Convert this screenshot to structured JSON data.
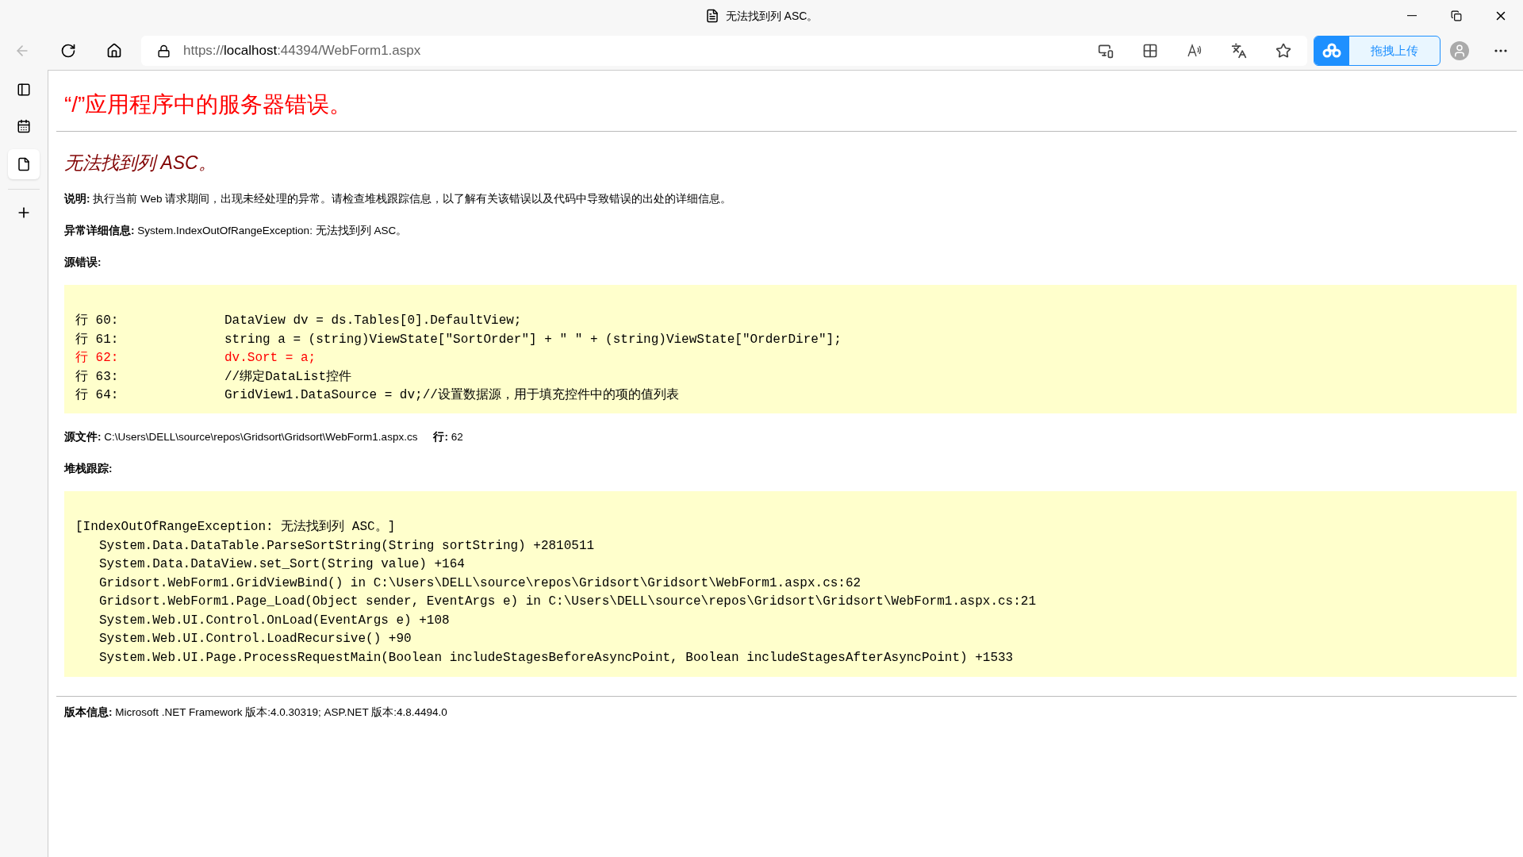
{
  "window": {
    "title": "无法找到列 ASC。"
  },
  "address_bar": {
    "scheme": "https://",
    "host": "localhost",
    "path": ":44394/WebForm1.aspx"
  },
  "upload_button": {
    "label": "拖拽上传"
  },
  "sidebar": {
    "items": [
      {
        "kind": "tabs",
        "selected": false
      },
      {
        "kind": "calendar",
        "selected": false
      },
      {
        "kind": "page",
        "selected": true
      }
    ]
  },
  "page": {
    "heading": "“/”应用程序中的服务器错误。",
    "subheading": "无法找到列 ASC。",
    "description": {
      "label": "说明:",
      "text": "执行当前 Web 请求期间，出现未经处理的异常。请检查堆栈跟踪信息，以了解有关该错误以及代码中导致错误的出处的详细信息。"
    },
    "exception_details": {
      "label": "异常详细信息:",
      "text": "System.IndexOutOfRangeException: 无法找到列 ASC。"
    },
    "source_error": {
      "label": "源错误:",
      "lines": [
        {
          "prefix": "行 60:",
          "code": "DataView dv = ds.Tables[0].DefaultView;",
          "error": false
        },
        {
          "prefix": "行 61:",
          "code": "string a = (string)ViewState[\"SortOrder\"] + \" \" + (string)ViewState[\"OrderDire\"];",
          "error": false
        },
        {
          "prefix": "行 62:",
          "code": "dv.Sort = a;",
          "error": true
        },
        {
          "prefix": "行 63:",
          "code": "//绑定DataList控件",
          "error": false
        },
        {
          "prefix": "行 64:",
          "code": "GridView1.DataSource = dv;//设置数据源，用于填充控件中的项的值列表",
          "error": false
        }
      ]
    },
    "source_file": {
      "label": "源文件:",
      "path": "C:\\Users\\DELL\\source\\repos\\Gridsort\\Gridsort\\WebForm1.aspx.cs",
      "line_label": "行:",
      "line": "62"
    },
    "stack_trace": {
      "label": "堆栈跟踪:",
      "exception": "[IndexOutOfRangeException: 无法找到列 ASC。]",
      "frames": [
        "System.Data.DataTable.ParseSortString(String sortString) +2810511",
        "System.Data.DataView.set_Sort(String value) +164",
        "Gridsort.WebForm1.GridViewBind() in C:\\Users\\DELL\\source\\repos\\Gridsort\\Gridsort\\WebForm1.aspx.cs:62",
        "Gridsort.WebForm1.Page_Load(Object sender, EventArgs e) in C:\\Users\\DELL\\source\\repos\\Gridsort\\Gridsort\\WebForm1.aspx.cs:21",
        "System.Web.UI.Control.OnLoad(EventArgs e) +108",
        "System.Web.UI.Control.LoadRecursive() +90",
        "System.Web.UI.Page.ProcessRequestMain(Boolean includeStagesBeforeAsyncPoint, Boolean includeStagesAfterAsyncPoint) +1533"
      ]
    },
    "version": {
      "label": "版本信息:",
      "text": "Microsoft .NET Framework 版本:4.0.30319; ASP.NET 版本:4.8.4494.0"
    }
  }
}
